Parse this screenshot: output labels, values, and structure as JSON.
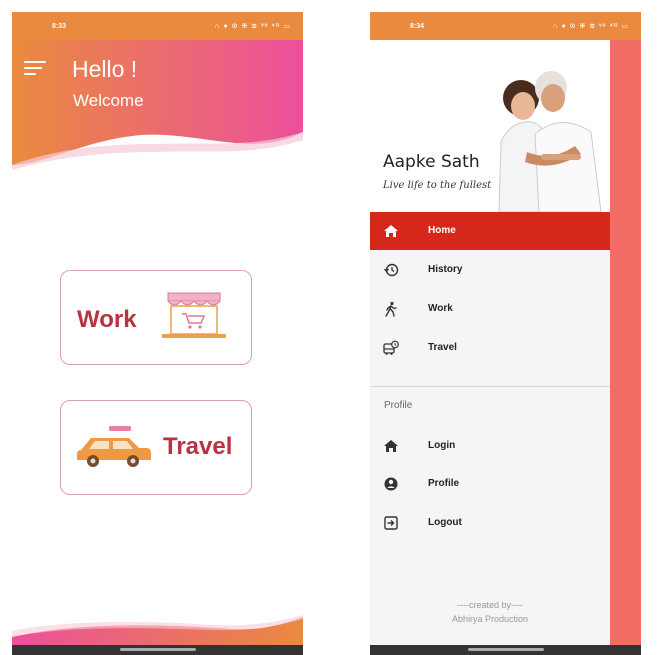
{
  "left_screen": {
    "status_time": "8:33",
    "status_icons": "∩ ● ⊙ ⁜ ≋ ᵛᵒ ⁴ᴳ ▭",
    "greeting": "Hello !",
    "subtitle": "Welcome",
    "cards": {
      "work": "Work",
      "travel": "Travel"
    }
  },
  "right_screen": {
    "status_time": "8:34",
    "status_icons": "∩ ● ⊙ ⁜ ≋ ᵛᵒ ⁴ᴳ ▭",
    "drawer_title": "Aapke Sath",
    "drawer_subtitle": "Live life to the fullest",
    "menu": [
      {
        "label": "Home",
        "icon": "home-icon",
        "active": true
      },
      {
        "label": "History",
        "icon": "history-icon",
        "active": false
      },
      {
        "label": "Work",
        "icon": "walk-icon",
        "active": false
      },
      {
        "label": "Travel",
        "icon": "bus-icon",
        "active": false
      }
    ],
    "section_label": "Profile",
    "profile_menu": [
      {
        "label": "Login",
        "icon": "home-icon"
      },
      {
        "label": "Profile",
        "icon": "account-icon"
      },
      {
        "label": "Logout",
        "icon": "logout-icon"
      }
    ],
    "credit_line_1": "----created by----",
    "credit_line_2": "Abhirya Production"
  },
  "colors": {
    "orange": "#ea8a3e",
    "pink": "#ec4f9d",
    "active_red": "#d6271d",
    "card_text": "#b83240",
    "side_scrim": "#f26d65"
  }
}
